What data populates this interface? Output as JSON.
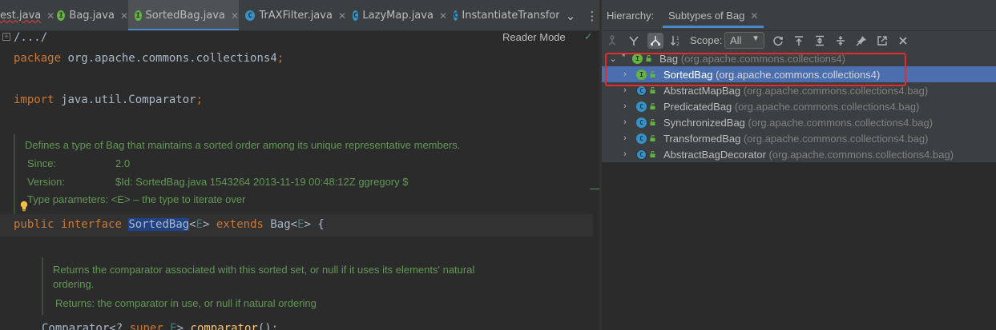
{
  "editor": {
    "tabs": [
      {
        "label": "est.java",
        "icon": "none",
        "error": true
      },
      {
        "label": "Bag.java",
        "icon": "interface-icon"
      },
      {
        "label": "SortedBag.java",
        "icon": "interface-icon",
        "active": true
      },
      {
        "label": "TrAXFilter.java",
        "icon": "class-icon"
      },
      {
        "label": "LazyMap.java",
        "icon": "class-icon"
      },
      {
        "label": "InstantiateTransfor",
        "icon": "class-icon"
      }
    ],
    "path": "/.../",
    "reader_mode": "Reader Mode",
    "code": {
      "package_kw": "package",
      "package_name": "org.apache.commons.collections4",
      "semicolon": ";",
      "import_kw": "import",
      "import_name": "java.util.Comparator",
      "decl_public": "public",
      "decl_interface": "interface",
      "decl_name": "SortedBag",
      "decl_lt": "<",
      "decl_tp": "E",
      "decl_gt": ">",
      "decl_extends": "extends",
      "decl_bag": "Bag",
      "decl_brace": "{",
      "method_type": "Comparator",
      "method_lt": "<",
      "method_q": "?",
      "method_super": "super",
      "method_e": "E",
      "method_gt": ">",
      "method_name": "comparator",
      "method_parens": "();"
    },
    "doc1": {
      "description": "Defines a type of Bag that maintains a sorted order among its unique representative members.",
      "since_label": "Since:",
      "since_value": "2.0",
      "version_label": "Version:",
      "version_value": "$Id: SortedBag.java 1543264 2013-11-19 00:48:12Z ggregory $",
      "type_params": "Type parameters: <E> – the type to iterate over"
    },
    "doc2": {
      "description_line1": "Returns the comparator associated with this sorted set, or null if it uses its elements' natural",
      "description_line2": "ordering.",
      "returns": "Returns: the comparator in use, or null if natural ordering"
    }
  },
  "hierarchy": {
    "label": "Hierarchy:",
    "tab_label": "Subtypes of Bag",
    "scope_label": "Scope:",
    "scope_value": "All",
    "tree": [
      {
        "name": "Bag",
        "pkg": "(org.apache.commons.collections4)",
        "kind": "interface",
        "expanded": true,
        "root": true
      },
      {
        "name": "SortedBag",
        "pkg": "(org.apache.commons.collections4)",
        "kind": "interface",
        "selected": true
      },
      {
        "name": "AbstractMapBag",
        "pkg": "(org.apache.commons.collections4.bag)",
        "kind": "abstract-class"
      },
      {
        "name": "PredicatedBag",
        "pkg": "(org.apache.commons.collections4.bag)",
        "kind": "class"
      },
      {
        "name": "SynchronizedBag",
        "pkg": "(org.apache.commons.collections4.bag)",
        "kind": "class"
      },
      {
        "name": "TransformedBag",
        "pkg": "(org.apache.commons.collections4.bag)",
        "kind": "class"
      },
      {
        "name": "AbstractBagDecorator",
        "pkg": "(org.apache.commons.collections4.bag)",
        "kind": "abstract-class"
      }
    ]
  },
  "colors": {
    "accent": "#4a88c7",
    "selection": "#4b6eaf",
    "annotation": "#e32d2d",
    "interface_icon": "#62b543",
    "class_icon": "#3592c4"
  }
}
